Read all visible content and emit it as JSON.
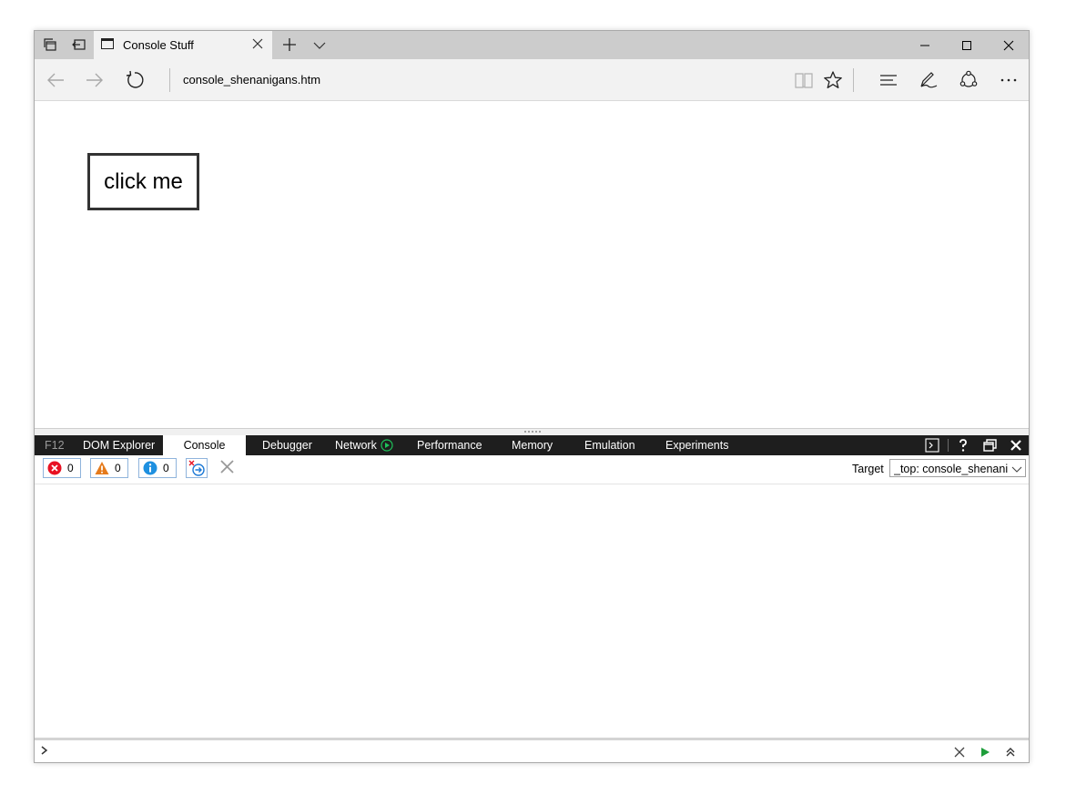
{
  "browser": {
    "tab": {
      "title": "Console Stuff"
    },
    "address_bar": {
      "url": "console_shenanigans.htm"
    }
  },
  "page": {
    "button_label": "click me"
  },
  "devtools": {
    "tabs": [
      {
        "label": "F12"
      },
      {
        "label": "DOM Explorer"
      },
      {
        "label": "Console"
      },
      {
        "label": "Debugger"
      },
      {
        "label": "Network"
      },
      {
        "label": "Performance"
      },
      {
        "label": "Memory"
      },
      {
        "label": "Emulation"
      },
      {
        "label": "Experiments"
      }
    ],
    "active_tab": "Console",
    "counters": {
      "errors": "0",
      "warnings": "0",
      "info": "0"
    },
    "target": {
      "label": "Target",
      "value": "_top: console_shenanigans.htm"
    }
  },
  "colors": {
    "error": "#e81123",
    "warning": "#e57b1c",
    "info": "#1e90e0",
    "run": "#1e9e3a"
  }
}
